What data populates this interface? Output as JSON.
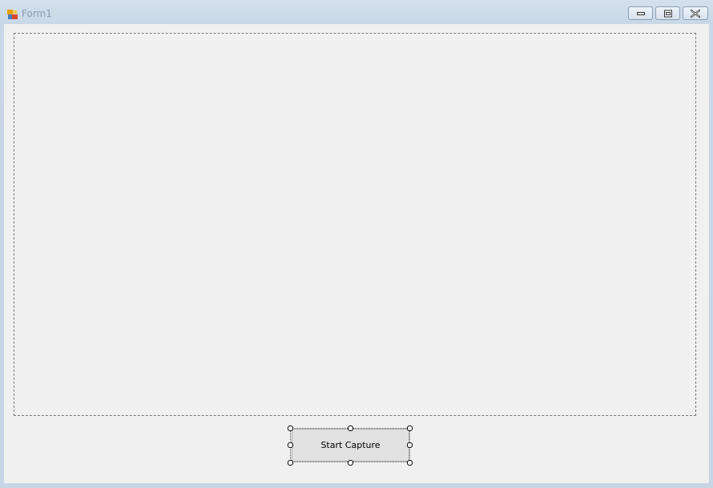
{
  "window": {
    "title": "Form1",
    "icon": "form-icon"
  },
  "titlebar_buttons": {
    "minimize_icon": "minimize-icon",
    "maximize_icon": "maximize-icon",
    "close_icon": "close-icon"
  },
  "form": {
    "panel": "capture-panel",
    "button_label": "Start Capture",
    "selected": true
  }
}
